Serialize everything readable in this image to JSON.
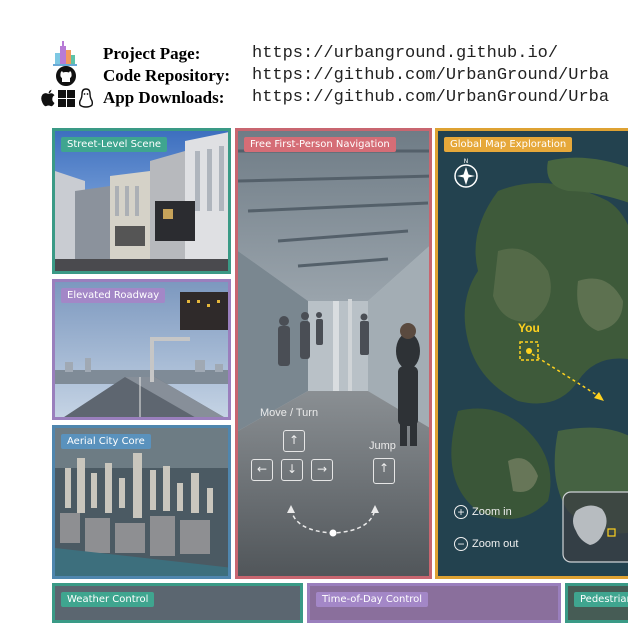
{
  "header": {
    "rows": [
      {
        "label": "Project Page:",
        "url": "https://urbanground.github.io/"
      },
      {
        "label": "Code Repository:",
        "url": "https://github.com/UrbanGround/Urba"
      },
      {
        "label": "App Downloads:",
        "url": "https://github.com/UrbanGround/Urba"
      }
    ]
  },
  "panels": {
    "street_level": "Street-Level Scene",
    "elevated": "Elevated Roadway",
    "aerial": "Aerial City Core",
    "navigation": "Free First-Person Navigation",
    "map": "Global Map Exploration",
    "weather": "Weather Control",
    "time_of_day": "Time-of-Day Control",
    "pedestrian": "Pedestrian"
  },
  "navigation": {
    "move_turn": "Move / Turn",
    "jump": "Jump"
  },
  "map": {
    "you_label": "You",
    "zoom_in": "Zoom in",
    "zoom_out": "Zoom out"
  },
  "colors": {
    "teal": "#3fa58f",
    "purple": "#a387c7",
    "blue": "#5a92bd",
    "red": "#d56d76",
    "orange": "#e6a83a",
    "you_marker": "#ffd21f"
  }
}
